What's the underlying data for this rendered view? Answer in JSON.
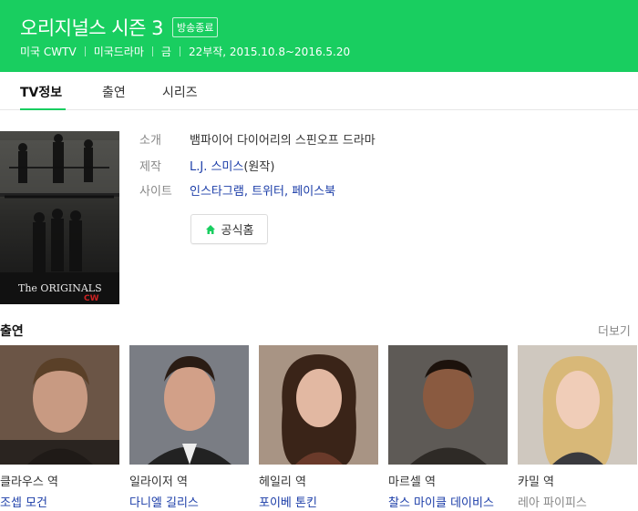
{
  "header": {
    "title": "오리지널스 시즌 3",
    "badge": "방송종료",
    "meta": [
      "미국 CWTV",
      "미국드라마",
      "금",
      "22부작, 2015.10.8~2016.5.20"
    ],
    "bg_color": "#19ce60"
  },
  "tabs": [
    {
      "label": "TV정보",
      "active": true
    },
    {
      "label": "출연",
      "active": false
    },
    {
      "label": "시리즈",
      "active": false
    }
  ],
  "info": {
    "intro_label": "소개",
    "intro_value": "뱀파이어 다이어리의 스핀오프 드라마",
    "producer_label": "제작",
    "producer_name": "L.J. 스미스",
    "producer_suffix": "(원작)",
    "site_label": "사이트",
    "sites": [
      "인스타그램",
      "트위터",
      "페이스북"
    ],
    "site_separator": ", ",
    "home_button": "공식홈",
    "home_icon": "home-icon"
  },
  "poster": {
    "logo_text": "The ORIGINALS",
    "network": "CW"
  },
  "cast_section": {
    "title": "출연",
    "more": "더보기",
    "members": [
      {
        "role": "클라우스 역",
        "actor": "조셉 모건",
        "linked": true
      },
      {
        "role": "일라이저 역",
        "actor": "다니엘 길리스",
        "linked": true
      },
      {
        "role": "헤일리 역",
        "actor": "포이베 톤킨",
        "linked": true
      },
      {
        "role": "마르셀 역",
        "actor": "찰스 마이클 데이비스",
        "linked": true
      },
      {
        "role": "카밀 역",
        "actor": "레아 파이피스",
        "linked": false
      }
    ]
  }
}
